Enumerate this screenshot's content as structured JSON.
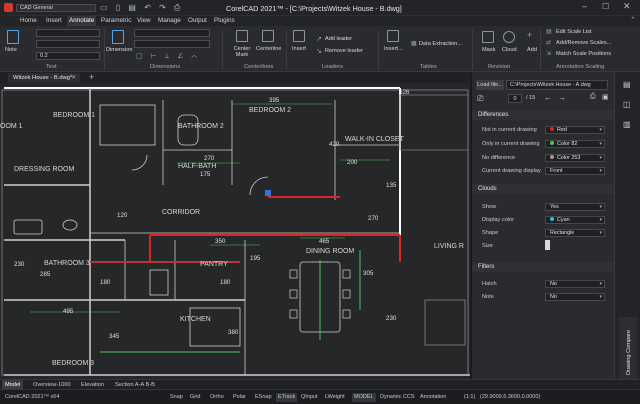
{
  "app": {
    "workspace": "CAD General",
    "title": "CorelCAD 2021™ - [C:\\Projects\\Witzek House - B.dwg]"
  },
  "menu": [
    "Home",
    "Insert",
    "Annotate",
    "Parametric",
    "View",
    "Manage",
    "Output",
    "Plugins"
  ],
  "ribbon": {
    "note_label": "Note",
    "text_group": "Text",
    "text_height": "0.2",
    "dimension_label": "Dimension",
    "dimensions_group": "Dimensions",
    "center_mark_label": "Center Mark",
    "centerline_label": "Centerline",
    "centerlines_group": "Centerlines",
    "insert_label": "Insert",
    "add_leader": "Add leader",
    "remove_leader": "Remove leader",
    "leaders_group": "Leaders",
    "table_insert": "Insert...",
    "data_extraction": "Data Extraction...",
    "tables_group": "Tables",
    "mask_label": "Mask",
    "cloud_label": "Cloud",
    "add_label": "Add",
    "revision_group": "Revision",
    "edit_scale_list": "Edit Scale List",
    "add_remove_scales": "Add/Remove Scales...",
    "match_scale_positions": "Match Scale Positions",
    "annotation_scaling_group": "Annotation Scaling"
  },
  "doc_tab": "Witzek House - B.dwg*",
  "panel": {
    "load_file_btn": "Load file...",
    "file_path": "C:\\Projects\\Witzek House - A.dwg",
    "page_current": "0",
    "page_total": "/ 15",
    "differences": {
      "title": "Differences",
      "rows": [
        {
          "label": "Not in current drawing",
          "value": "Red",
          "color": "#e02424"
        },
        {
          "label": "Only in current drawing",
          "value": "Color 82",
          "color": "#4cc35a"
        },
        {
          "label": "No difference",
          "value": "Color 253",
          "color": "#9a9a9a"
        },
        {
          "label": "Current drawing display",
          "value": "Front",
          "color": ""
        }
      ]
    },
    "clouds": {
      "title": "Clouds",
      "rows": [
        {
          "label": "Show",
          "value": "Yes",
          "color": ""
        },
        {
          "label": "Display color",
          "value": "Cyan",
          "color": "#22c7d6"
        },
        {
          "label": "Shape",
          "value": "Rectangle",
          "color": ""
        },
        {
          "label": "Size",
          "value": "",
          "color": ""
        }
      ]
    },
    "filters": {
      "title": "Filters",
      "rows": [
        {
          "label": "Hatch",
          "value": "No",
          "color": ""
        },
        {
          "label": "Note",
          "value": "No",
          "color": ""
        }
      ]
    },
    "vertical_tab": "Drawing Compare"
  },
  "drawing": {
    "rooms": [
      "BEDROOM 1",
      "BATHROOM 2",
      "BEDROOM 2",
      "WALK-IN CLOSET",
      "DRESSING ROOM",
      "HALF-BATH",
      "CORRIDOR",
      "BATHROOM 3",
      "PANTRY",
      "DINING ROOM",
      "LIVING R",
      "KITCHEN",
      "BEDROOM 3",
      "OOM 1"
    ],
    "dimensions": [
      "626",
      "395",
      "420",
      "200",
      "270",
      "175",
      "135",
      "120",
      "270",
      "350",
      "465",
      "195",
      "230",
      "285",
      "180",
      "180",
      "305",
      "495",
      "380",
      "345",
      "230"
    ]
  },
  "layout_tabs": [
    "Model",
    "Overview-1000",
    "Elevation",
    "Section A-A B-B"
  ],
  "status": {
    "app": "CorelCAD 2021™ x64",
    "toggles": [
      "Snap",
      "Grid",
      "Ortho",
      "Polar",
      "ESnap",
      "ETrack",
      "QInput",
      "LWeight",
      "MODEL",
      "Dynamic CCS",
      "Annotation"
    ],
    "scale": "(1:1)",
    "coords": "(29.9009,6.3600,0.0000)"
  }
}
